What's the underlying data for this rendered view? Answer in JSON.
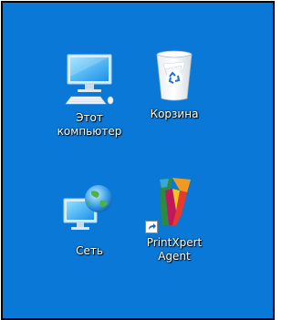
{
  "desktop": {
    "background_color": "#0a78d7",
    "icons": [
      {
        "id": "this-pc",
        "icon": "computer-monitor-icon",
        "label_lines": [
          "Этот",
          "компьютер"
        ]
      },
      {
        "id": "recycle-bin",
        "icon": "recycle-bin-icon",
        "label_lines": [
          "Корзина"
        ]
      },
      {
        "id": "network",
        "icon": "network-globe-icon",
        "label_lines": [
          "Сеть"
        ]
      },
      {
        "id": "printxpert-agent",
        "icon": "printxpert-logo-icon",
        "label_lines": [
          "PrintXpert",
          "Agent"
        ],
        "shortcut": true
      }
    ]
  }
}
